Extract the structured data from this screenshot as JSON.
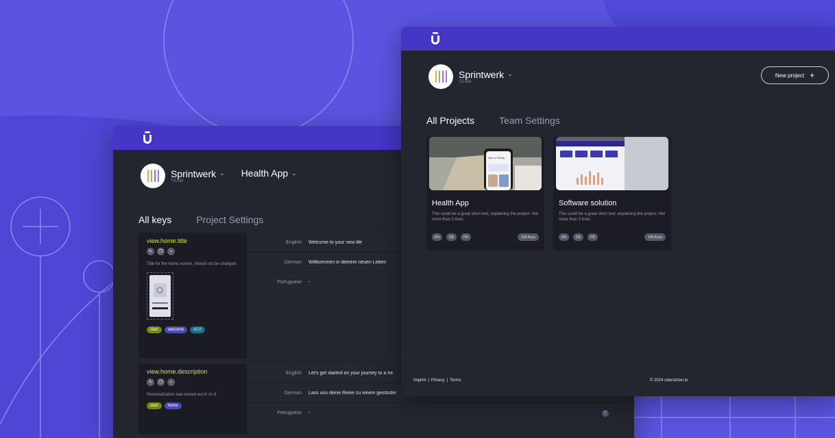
{
  "colors": {
    "background": "#5b54e0",
    "topbar": "#4437c6",
    "panel": "#23262f",
    "key_name": "#d4e44d",
    "tag_start": "#76890f",
    "tag_welcome": "#4b4bb5",
    "tag_version": "#1f6d7f"
  },
  "icons": [
    "ubersetzer-logo-icon",
    "chevron-down-icon",
    "edit-icon",
    "copy-icon",
    "delete-icon",
    "plus-icon",
    "info-icon"
  ],
  "keys_window": {
    "team": {
      "name": "Sprintwerk",
      "sub": "TEAM"
    },
    "project": "Health App",
    "tabs": [
      "All keys",
      "Project Settings"
    ],
    "keys": [
      {
        "name": "view.home.title",
        "description": "Title for the home screen, should not be changed",
        "tags": [
          "start",
          "welcome",
          "v2.0"
        ],
        "translations": [
          {
            "lang": "English",
            "value": "Welcome to your new life"
          },
          {
            "lang": "German",
            "value": "Willkommen in deinem neuen Leben"
          },
          {
            "lang": "Portuguese",
            "value": "-"
          }
        ]
      },
      {
        "name": "view.home.description",
        "description": "Personalization was kicked out in v1.8",
        "tags": [
          "start",
          "home"
        ],
        "translations": [
          {
            "lang": "English",
            "value": "Let's get started on your journey to a he"
          },
          {
            "lang": "German",
            "value": "Lass uns deine Reise zu einem gesünder"
          },
          {
            "lang": "Portuguese",
            "value": "-"
          }
        ]
      }
    ]
  },
  "projects_window": {
    "team": {
      "name": "Sprintwerk",
      "sub": "TEAM"
    },
    "new_project_label": "New project",
    "tabs": [
      "All Projects",
      "Team Settings"
    ],
    "projects": [
      {
        "title": "Health App",
        "description": "This could be a great short text, explaining the project. Not more than 3 lines",
        "langs": [
          "EN",
          "DE",
          "FR"
        ],
        "keys": "156 Keys",
        "screen_heading": "Kiss & Family"
      },
      {
        "title": "Software solution",
        "description": "This could be a great short text, explaining the project. Not more than 3 lines",
        "langs": [
          "EN",
          "DE",
          "FR"
        ],
        "keys": "156 Keys"
      }
    ],
    "footer": {
      "imprint": "Imprint",
      "privacy": "Privacy",
      "terms": "Terms",
      "sep": "|",
      "copyright": "© 2024 ubersetzer.io"
    }
  }
}
